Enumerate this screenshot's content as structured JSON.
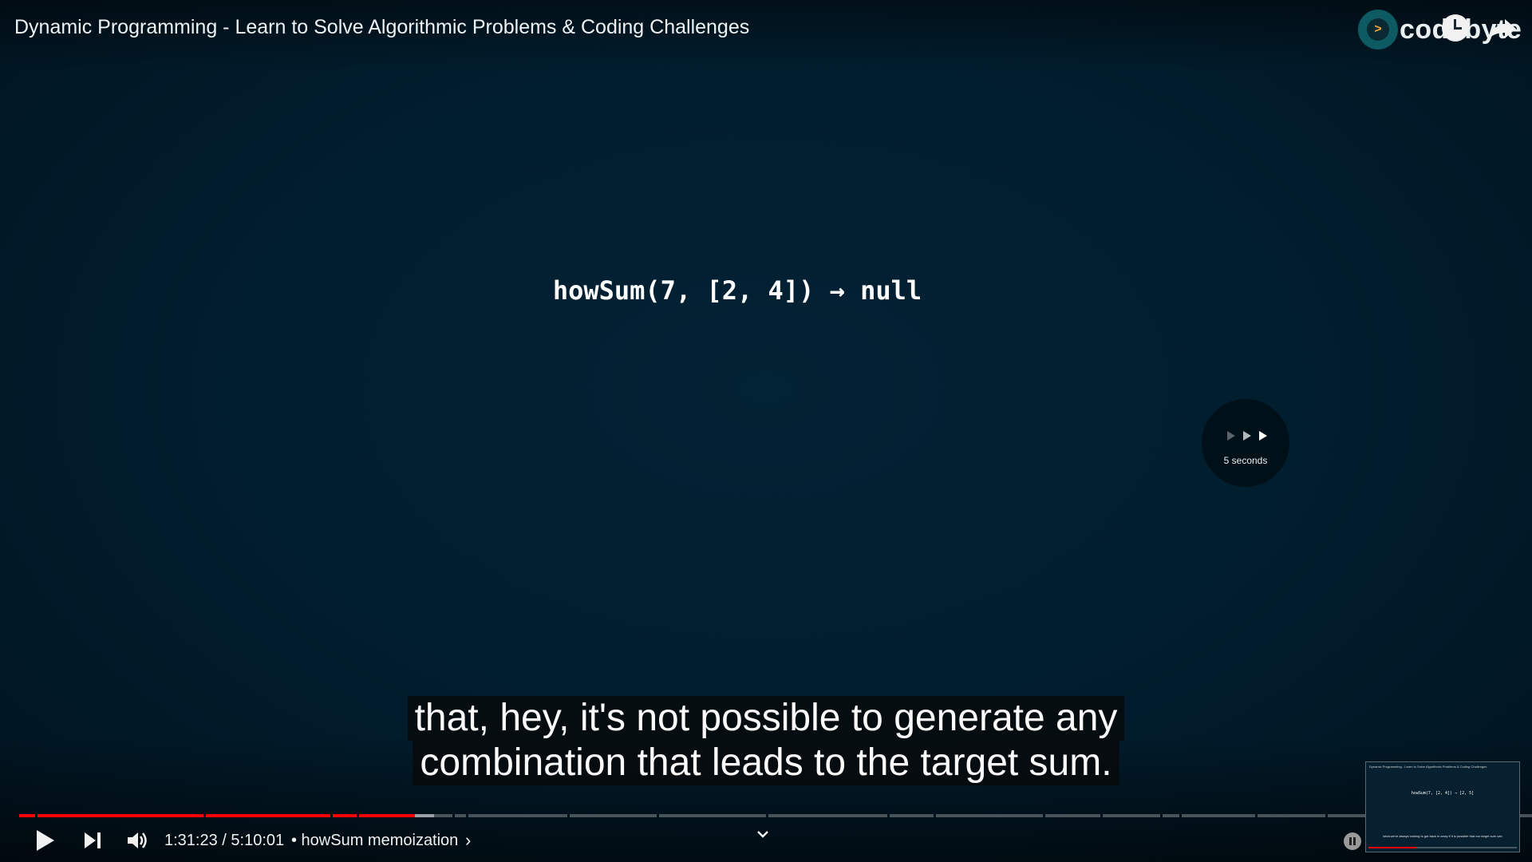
{
  "video": {
    "title": "Dynamic Programming - Learn to Solve Algorithmic Problems & Coding Challenges",
    "slide_text": "howSum(7, [2, 4]) → null",
    "captions": [
      "that, hey, it's not possible to generate any",
      "combination that leads to the target sum."
    ]
  },
  "channel": {
    "logo_text": "codebyte",
    "logo_glyph": ">"
  },
  "seek_indicator": {
    "label": "5 seconds",
    "icon": "fast-forward-icon"
  },
  "controls": {
    "time": "1:31:23 / 5:10:01",
    "chapter": "• howSum memoization",
    "chapter_chevron": "›",
    "icons": [
      "play-icon",
      "next-icon",
      "volume-icon",
      "chevron-down-icon",
      "pause-icon",
      "watch-later-icon",
      "share-icon"
    ]
  },
  "progress": {
    "played_fraction": 0.2946,
    "chapters_played": 6
  },
  "miniplayer": {
    "slide_text": "howSum(7, [2, 4]) → [2, 5]",
    "caption": "what we're always looking to get back in array if it is possible that our target sum can"
  },
  "colors": {
    "background": "#022235",
    "progress_played": "#ff0000",
    "caption_bg": "#080808"
  }
}
